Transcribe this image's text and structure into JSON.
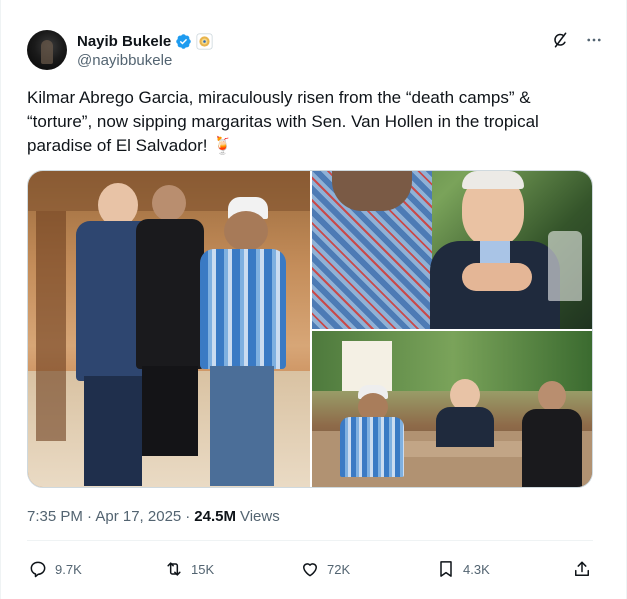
{
  "author": {
    "display_name": "Nayib Bukele",
    "handle": "@nayibbukele",
    "verified_badge": "verified-badge-icon",
    "affiliation_badge": "government-affiliation-icon"
  },
  "header_actions": {
    "grok_icon": "grok-icon",
    "more_icon": "more-icon"
  },
  "tweet": {
    "text": "Kilmar Abrego Garcia, miraculously risen from the “death camps” & “torture”, now sipping margaritas with Sen. Van Hollen in the tropical paradise of El Salvador! 🍹"
  },
  "media": {
    "photo_count": 3
  },
  "meta": {
    "timestamp": "7:35 PM · Apr 17, 2025",
    "separator": "·",
    "views_count": "24.5M",
    "views_label": "Views"
  },
  "actions": {
    "replies": "9.7K",
    "reposts": "15K",
    "likes": "72K",
    "bookmarks": "4.3K"
  },
  "colors": {
    "text_primary": "#0f1419",
    "text_secondary": "#536471",
    "verified_blue": "#1d9bf0",
    "border": "#cfd9de"
  }
}
